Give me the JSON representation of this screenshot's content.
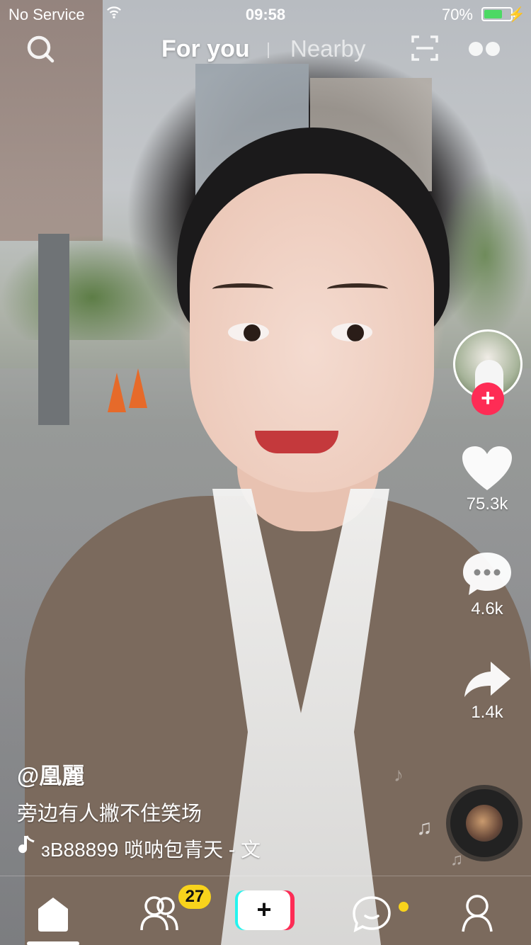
{
  "status_bar": {
    "carrier": "No Service",
    "time": "09:58",
    "battery_pct": "70%",
    "battery_level": 0.7
  },
  "top_nav": {
    "tab_for_you": "For you",
    "tab_nearby": "Nearby",
    "active_tab": "For you"
  },
  "actions": {
    "likes": "75.3k",
    "comments": "4.6k",
    "shares": "1.4k"
  },
  "caption": {
    "username": "@凰麗",
    "description": "旁边有人撇不住笑场",
    "music": "ɜB88899   唢呐包青天 - 文"
  },
  "tab_bar": {
    "friends_badge": "27",
    "create_symbol": "+"
  },
  "colors": {
    "accent_pink": "#fe2c55",
    "accent_cyan": "#25f4ee",
    "badge_yellow": "#f8d31c",
    "battery_green": "#4cd964"
  },
  "icons": [
    "search-icon",
    "scan-icon",
    "two-dots-icon",
    "heart-icon",
    "comment-icon",
    "share-icon",
    "music-note-icon",
    "home-icon",
    "friends-icon",
    "inbox-icon",
    "profile-icon"
  ]
}
